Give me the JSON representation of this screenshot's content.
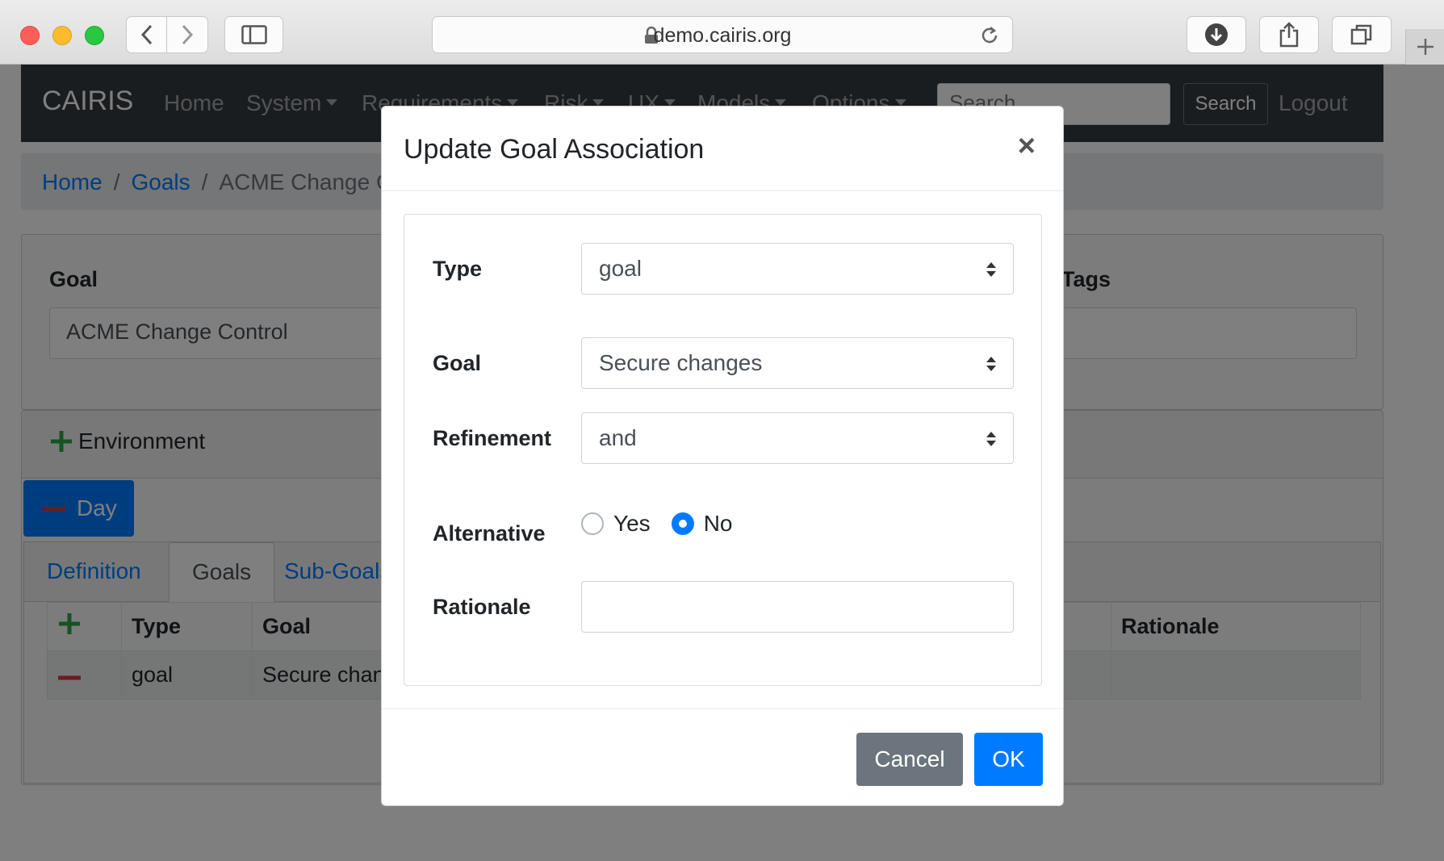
{
  "browser": {
    "url": "demo.cairis.org",
    "icons": [
      "back-icon",
      "forward-icon",
      "sidebar-icon",
      "lock-icon",
      "reload-icon",
      "download-icon",
      "share-icon",
      "tabs-icon",
      "new-tab-icon"
    ]
  },
  "navbar": {
    "brand": "CAIRIS",
    "links": [
      "Home",
      "System",
      "Requirements",
      "Risk",
      "UX",
      "Models",
      "Options"
    ],
    "search_placeholder": "Search",
    "search_button": "Search",
    "logout": "Logout"
  },
  "breadcrumb": {
    "home": "Home",
    "goals": "Goals",
    "current": "ACME Change Control"
  },
  "goal_form": {
    "goal_label": "Goal",
    "goal_value": "ACME Change Control",
    "tags_label": "Tags",
    "tags_value": ""
  },
  "environment": {
    "add_label": "Environment",
    "active_env": "Day",
    "tabs": [
      "Definition",
      "Goals",
      "Sub-Goals"
    ],
    "table": {
      "headers": [
        "Type",
        "Goal",
        "Rationale"
      ],
      "rows": [
        {
          "type": "goal",
          "goal": "Secure changes",
          "rationale": ""
        }
      ]
    }
  },
  "modal": {
    "title": "Update Goal Association",
    "close": "×",
    "type_label": "Type",
    "type_value": "goal",
    "goal_label": "Goal",
    "goal_value": "Secure changes",
    "refinement_label": "Refinement",
    "refinement_value": "and",
    "alternative_label": "Alternative",
    "alternative_options": [
      "Yes",
      "No"
    ],
    "alternative_selected": "No",
    "rationale_label": "Rationale",
    "rationale_value": "",
    "cancel": "Cancel",
    "ok": "OK"
  },
  "colors": {
    "primary": "#007bff",
    "secondary": "#6c757d",
    "navbar": "#343a40",
    "add_green": "#28a745",
    "remove_red": "#dc3545"
  }
}
